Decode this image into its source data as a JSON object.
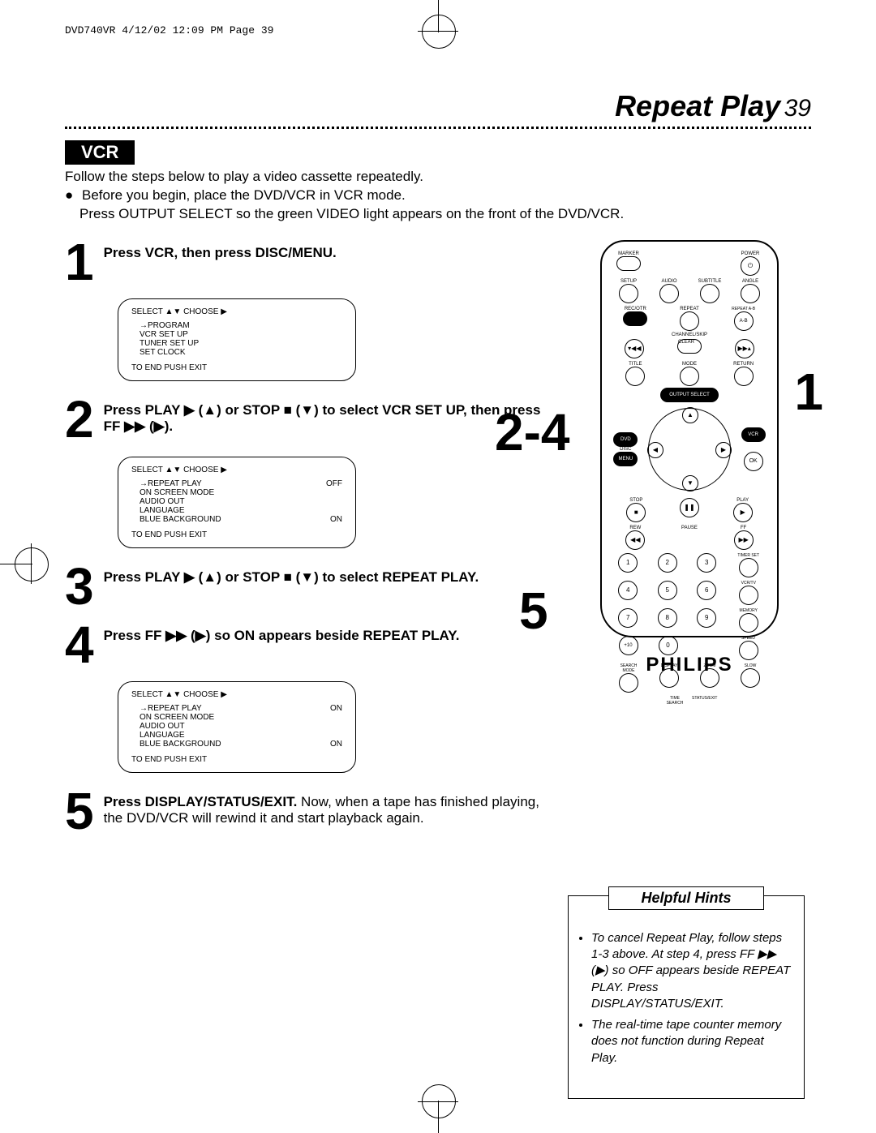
{
  "print_header": "DVD740VR  4/12/02  12:09 PM  Page 39",
  "title": "Repeat Play",
  "page_number": "39",
  "section_label": "VCR",
  "intro_line1": "Follow the steps below to play a video cassette repeatedly.",
  "intro_line2": "Before you begin, place the DVD/VCR in VCR mode.",
  "intro_line3": "Press OUTPUT SELECT so the green VIDEO light appears on the front of the DVD/VCR.",
  "steps": {
    "1": {
      "num": "1",
      "text_b": "Press VCR, then press DISC/MENU."
    },
    "2": {
      "num": "2",
      "text_b": "Press PLAY ▶ (▲) or STOP ■ (▼) to select VCR SET UP, then press FF ▶▶ (▶)."
    },
    "3": {
      "num": "3",
      "text_b": "Press PLAY ▶ (▲) or STOP ■ (▼) to select REPEAT PLAY."
    },
    "4": {
      "num": "4",
      "text_b": "Press FF ▶▶ (▶) so ON appears beside REPEAT PLAY."
    },
    "5": {
      "num": "5",
      "text_b": "Press DISPLAY/STATUS/EXIT.",
      "text_rest": " Now, when a tape has finished playing, the DVD/VCR will rewind it and start playback again."
    }
  },
  "osd1": {
    "header": "SELECT ▲▼  CHOOSE ▶",
    "lines": [
      "→PROGRAM",
      "  VCR SET UP",
      "  TUNER SET UP",
      "  SET CLOCK"
    ],
    "footer": "TO END PUSH EXIT"
  },
  "osd2": {
    "header": "SELECT ▲▼  CHOOSE ▶",
    "lines": [
      {
        "l": "→REPEAT PLAY",
        "r": "OFF"
      },
      {
        "l": "  ON SCREEN MODE",
        "r": ""
      },
      {
        "l": "  AUDIO OUT",
        "r": ""
      },
      {
        "l": "  LANGUAGE",
        "r": ""
      },
      {
        "l": "  BLUE BACKGROUND",
        "r": "ON"
      }
    ],
    "footer": "TO END PUSH EXIT"
  },
  "osd3": {
    "header": "SELECT ▲▼  CHOOSE ▶",
    "lines": [
      {
        "l": "→REPEAT PLAY",
        "r": "ON"
      },
      {
        "l": "  ON SCREEN MODE",
        "r": ""
      },
      {
        "l": "  AUDIO OUT",
        "r": ""
      },
      {
        "l": "  LANGUAGE",
        "r": ""
      },
      {
        "l": "  BLUE BACKGROUND",
        "r": "ON"
      }
    ],
    "footer": "TO END PUSH EXIT"
  },
  "callouts": {
    "c1": "1",
    "c24": "2-4",
    "c5": "5"
  },
  "remote": {
    "labels": {
      "marker": "MARKER",
      "power": "POWER",
      "setup": "SETUP",
      "audio": "AUDIO",
      "subtitle": "SUBTITLE",
      "angle": "ANGLE",
      "rec_otr": "REC/OTR",
      "repeat": "REPEAT",
      "repeat_ab": "REPEAT A-B",
      "channel_skip": "CHANNEL/SKIP",
      "clear": "CLEAR",
      "title": "TITLE",
      "mode": "MODE",
      "return": "RETURN",
      "output_select": "OUTPUT SELECT",
      "dvd": "DVD",
      "disc": "DISC",
      "menu": "MENU",
      "vcr": "VCR",
      "ok": "OK",
      "stop": "STOP",
      "play": "PLAY",
      "rew": "REW",
      "pause": "PAUSE",
      "ff": "FF",
      "timer_set": "TIMER SET",
      "vcr_tv": "VCR/TV",
      "memory": "MEMORY",
      "speed": "SPEED",
      "slow": "SLOW",
      "search": "SEARCH MODE",
      "display": "DISPLAY",
      "zoom": "ZOOM",
      "time_search": "TIME SEARCH",
      "status_exit": "STATUS/EXIT",
      "plus10": "+10"
    },
    "numbers": [
      "1",
      "2",
      "3",
      "4",
      "5",
      "6",
      "7",
      "8",
      "9",
      "0"
    ]
  },
  "brand": "PHILIPS",
  "hints": {
    "header": "Helpful Hints",
    "items": [
      "To cancel Repeat Play, follow steps 1-3 above. At step 4, press FF ▶▶ (▶) so OFF appears beside REPEAT PLAY. Press DISPLAY/STATUS/EXIT.",
      "The real-time tape counter memory does not function during Repeat Play."
    ]
  }
}
